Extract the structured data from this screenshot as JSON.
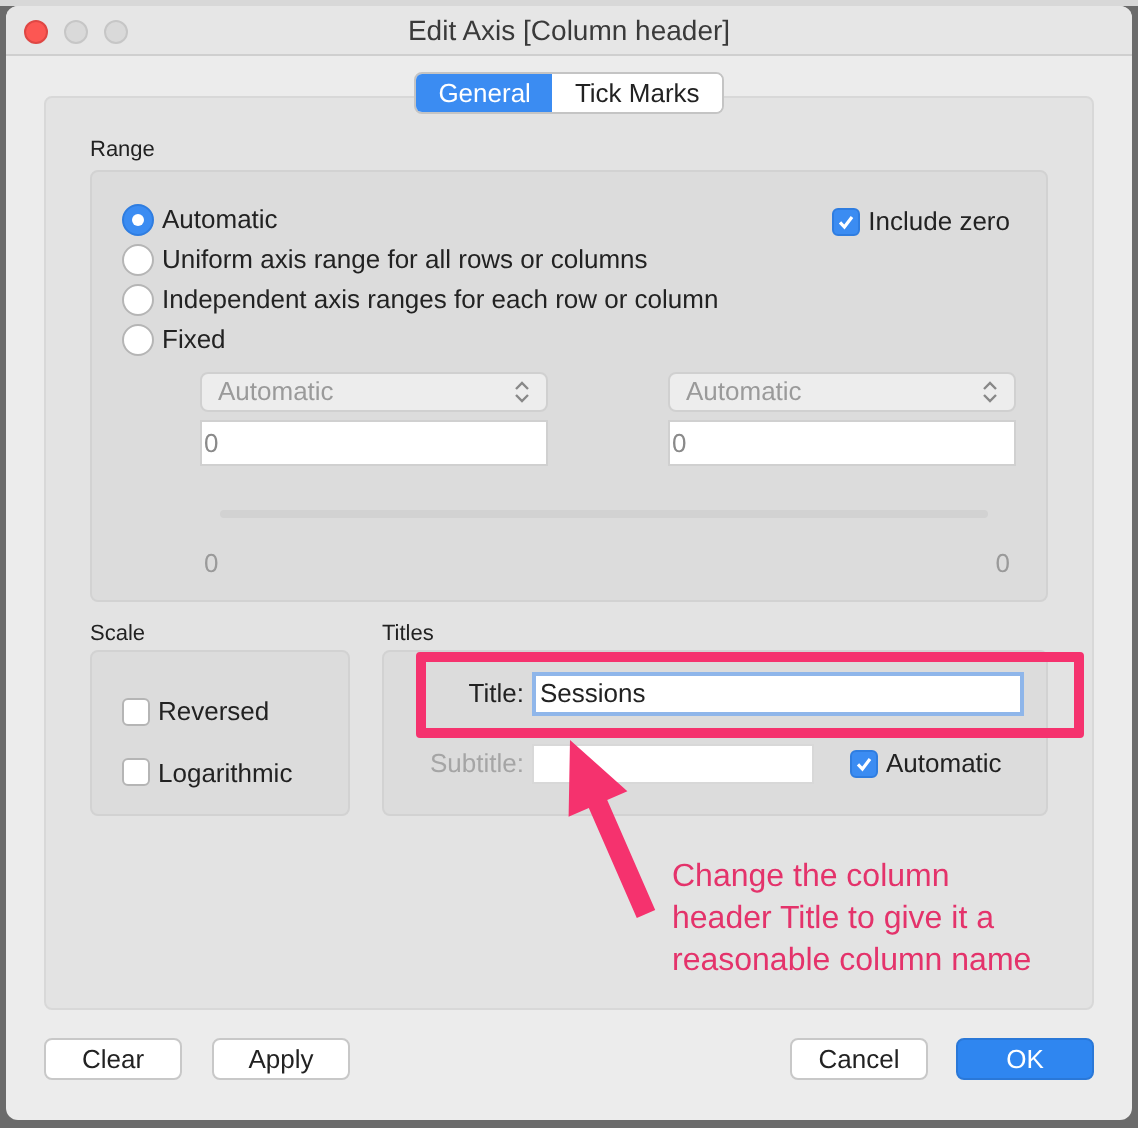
{
  "window": {
    "title": "Edit Axis [Column header]"
  },
  "tabs": [
    {
      "label": "General",
      "selected": true
    },
    {
      "label": "Tick Marks",
      "selected": false
    }
  ],
  "range": {
    "label": "Range",
    "options": [
      {
        "label": "Automatic",
        "selected": true
      },
      {
        "label": "Uniform axis range for all rows or columns",
        "selected": false
      },
      {
        "label": "Independent axis ranges for each row or column",
        "selected": false
      },
      {
        "label": "Fixed",
        "selected": false
      }
    ],
    "include_zero": {
      "label": "Include zero",
      "checked": true
    },
    "bounds": [
      {
        "mode": "Automatic",
        "value": "0"
      },
      {
        "mode": "Automatic",
        "value": "0"
      }
    ],
    "axis_labels": [
      "0",
      "0"
    ]
  },
  "scale": {
    "label": "Scale",
    "options": [
      {
        "label": "Reversed",
        "checked": false
      },
      {
        "label": "Logarithmic",
        "checked": false
      }
    ]
  },
  "titles": {
    "label": "Titles",
    "title": {
      "label": "Title:",
      "value": "Sessions"
    },
    "subtitle": {
      "label": "Subtitle:",
      "disabled": true
    },
    "automatic": {
      "label": "Automatic",
      "checked": true
    }
  },
  "annotation": "Change the column header Title to give it a reasonable column name",
  "buttons_left": [
    "Clear",
    "Apply"
  ],
  "buttons_right": [
    {
      "label": "Cancel",
      "default": false
    },
    {
      "label": "OK",
      "default": true
    }
  ]
}
